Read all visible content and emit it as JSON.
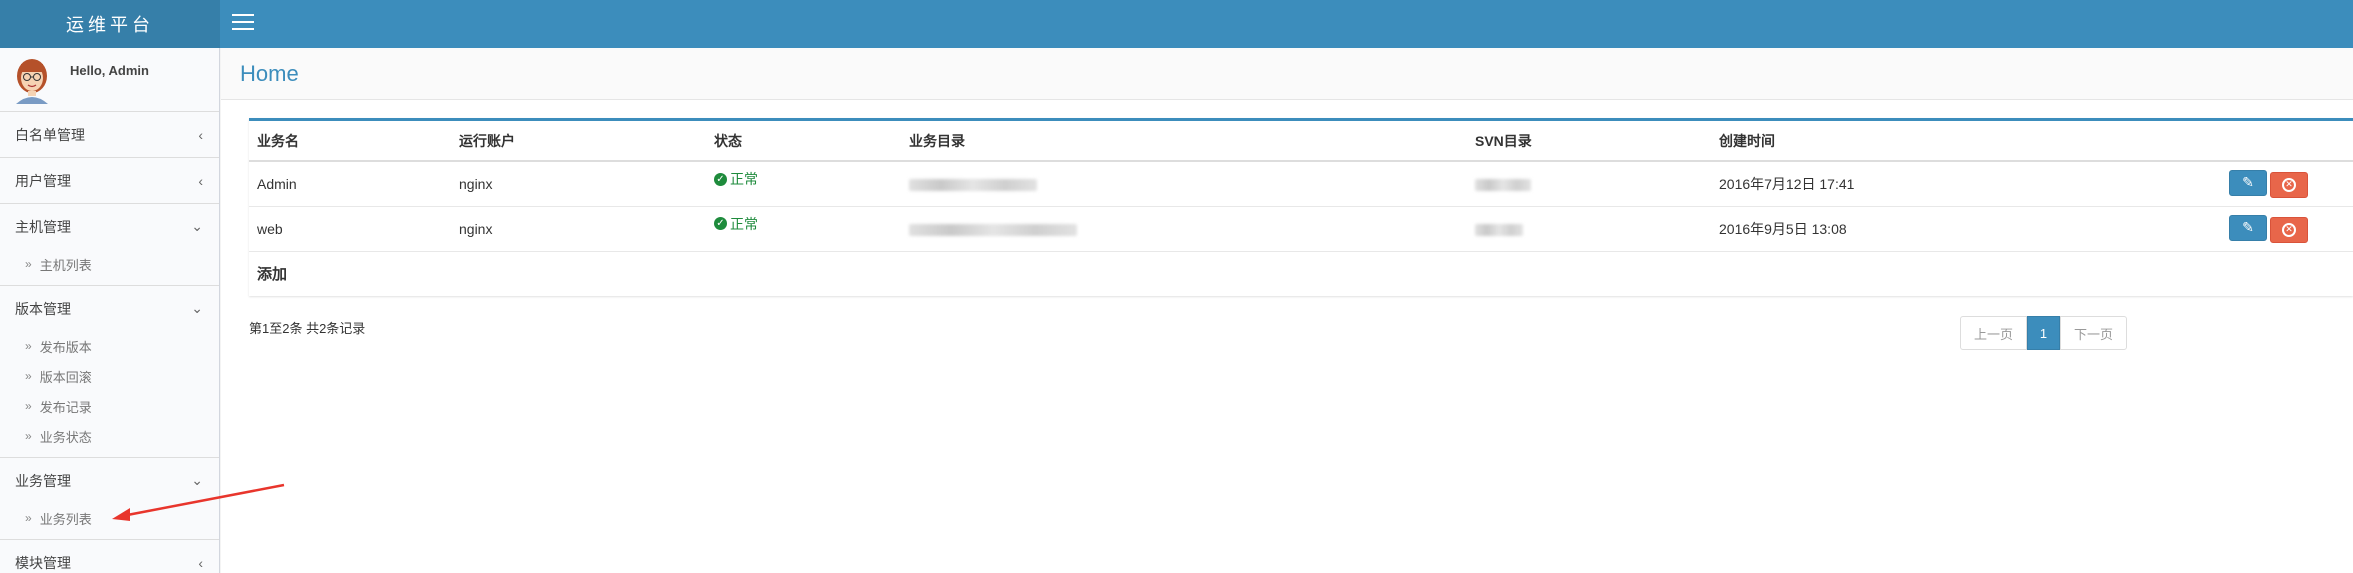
{
  "app": {
    "title": "运维平台"
  },
  "user": {
    "greeting": "Hello, Admin"
  },
  "sidebar": {
    "groups": [
      {
        "label": "白名单管理",
        "chevron": "‹",
        "items": []
      },
      {
        "label": "用户管理",
        "chevron": "‹",
        "items": []
      },
      {
        "label": "主机管理",
        "chevron": "⌄",
        "items": [
          "主机列表"
        ]
      },
      {
        "label": "版本管理",
        "chevron": "⌄",
        "items": [
          "发布版本",
          "版本回滚",
          "发布记录",
          "业务状态"
        ]
      },
      {
        "label": "业务管理",
        "chevron": "⌄",
        "items": [
          "业务列表"
        ]
      },
      {
        "label": "模块管理",
        "chevron": "‹",
        "items": []
      }
    ]
  },
  "page": {
    "title": "Home"
  },
  "table": {
    "headers": [
      "业务名",
      "运行账户",
      "状态",
      "业务目录",
      "SVN目录",
      "创建时间"
    ],
    "rows": [
      {
        "name": "Admin",
        "account": "nginx",
        "status": "正常",
        "created": "2016年7月12日 17:41"
      },
      {
        "name": "web",
        "account": "nginx",
        "status": "正常",
        "created": "2016年9月5日 13:08"
      }
    ],
    "add_label": "添加"
  },
  "pagination": {
    "info": "第1至2条 共2条记录",
    "prev": "上一页",
    "current": "1",
    "next": "下一页"
  },
  "colors": {
    "header": "#3c8dbc",
    "logo": "#367fa9",
    "status_ok": "#1e8b3c",
    "delete": "#e8664a",
    "annotation_arrow": "#e8352c"
  }
}
